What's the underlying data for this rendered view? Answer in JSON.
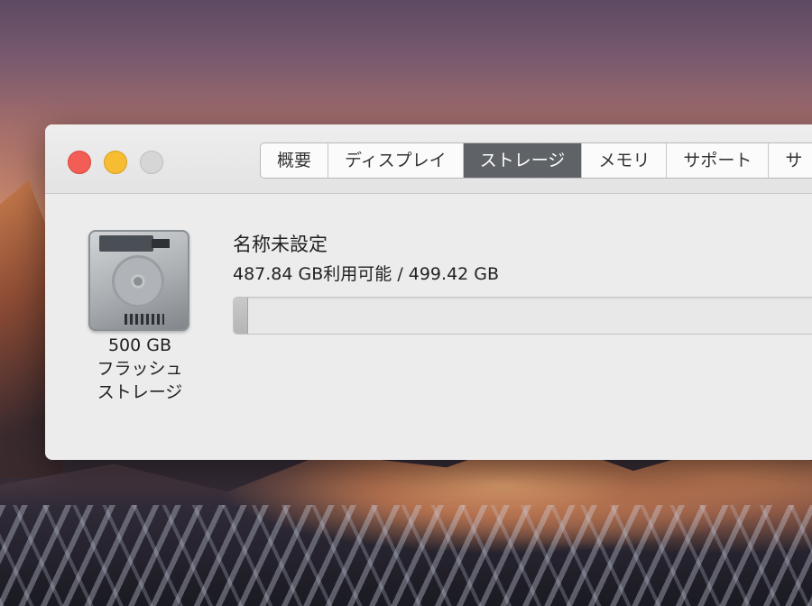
{
  "window": {
    "tabs": [
      {
        "label": "概要",
        "active": false
      },
      {
        "label": "ディスプレイ",
        "active": false
      },
      {
        "label": "ストレージ",
        "active": true
      },
      {
        "label": "メモリ",
        "active": false
      },
      {
        "label": "サポート",
        "active": false
      },
      {
        "label": "サ",
        "active": false
      }
    ]
  },
  "storage": {
    "disk_caption": [
      "500 GB",
      "フラッシュ",
      "ストレージ"
    ],
    "volume_name": "名称未設定",
    "usage_text": "487.84 GB利用可能 / 499.42 GB",
    "used_fraction": 0.023
  },
  "colors": {
    "close": "#f25d55",
    "minimize": "#f6bd32",
    "zoom": "#d6d6d6",
    "active_tab": "#5f6266"
  },
  "icons": {
    "disk": "hard-drive-icon"
  }
}
